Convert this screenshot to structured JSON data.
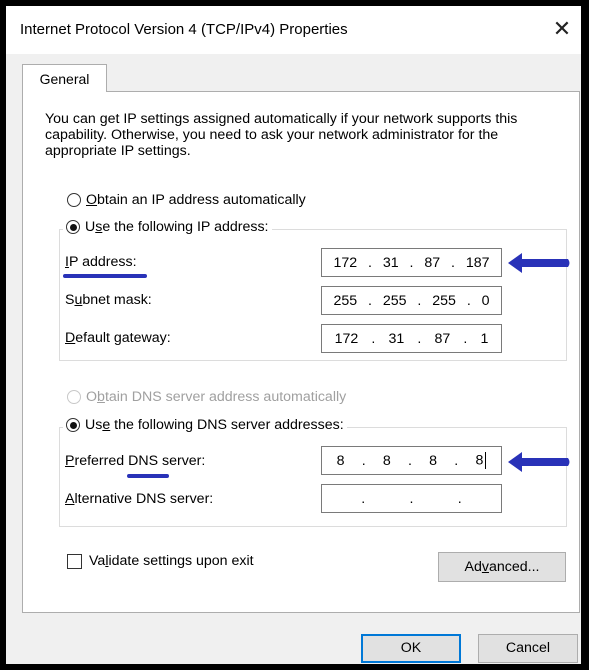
{
  "window": {
    "title": "Internet Protocol Version 4 (TCP/IPv4) Properties",
    "close_glyph": "✕"
  },
  "tabs": [
    "General"
  ],
  "description": "You can get IP settings assigned automatically if your network supports this capability. Otherwise, you need to ask your network administrator for the appropriate IP settings.",
  "ip_section": {
    "auto_option": {
      "mnemonic": "O",
      "rest": "btain an IP address automatically",
      "selected": false
    },
    "manual_option": {
      "pre": "U",
      "mnemonic": "s",
      "rest": "e the following IP address:",
      "selected": true
    },
    "fields": [
      {
        "pre": "",
        "mnemonic": "I",
        "rest": "P address:",
        "octets": [
          "172",
          "31",
          "87",
          "187"
        ]
      },
      {
        "pre": "S",
        "mnemonic": "u",
        "rest": "bnet mask:",
        "octets": [
          "255",
          "255",
          "255",
          "0"
        ]
      },
      {
        "pre": "",
        "mnemonic": "D",
        "rest": "efault gateway:",
        "octets": [
          "172",
          "31",
          "87",
          "1"
        ]
      }
    ]
  },
  "dns_section": {
    "auto_option": {
      "pre": "O",
      "mnemonic": "b",
      "rest": "tain DNS server address automatically",
      "enabled": false
    },
    "manual_option": {
      "pre": "Us",
      "mnemonic": "e",
      "rest": " the following DNS server addresses:",
      "selected": true
    },
    "fields": [
      {
        "pre": "",
        "mnemonic": "P",
        "rest": "referred DNS server:",
        "octets": [
          "8",
          "8",
          "8",
          "8"
        ]
      },
      {
        "pre": "",
        "mnemonic": "A",
        "rest": "lternative DNS server:",
        "octets": [
          "",
          "",
          "",
          ""
        ]
      }
    ]
  },
  "validate": {
    "pre": "Va",
    "mnemonic": "l",
    "rest": "idate settings upon exit",
    "checked": false
  },
  "buttons": {
    "advanced": {
      "pre": "Ad",
      "mnemonic": "v",
      "rest": "anced..."
    },
    "ok": "OK",
    "cancel": "Cancel"
  },
  "annotation_color": "#2932b8"
}
